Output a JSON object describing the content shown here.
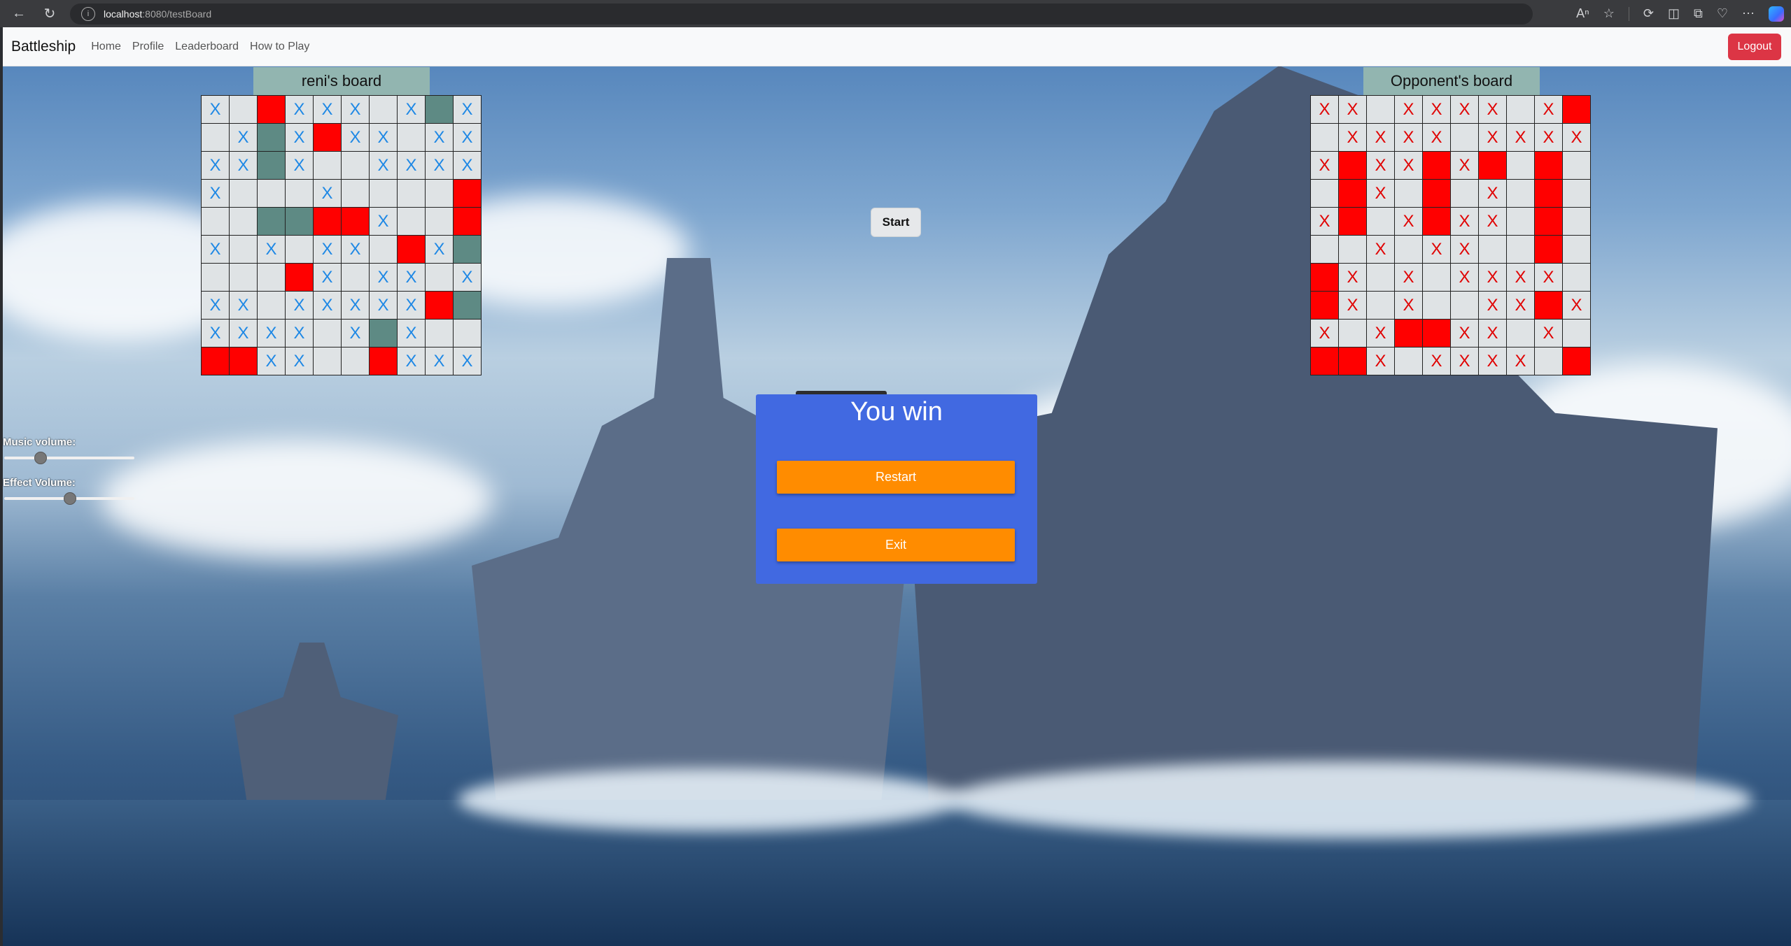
{
  "browser": {
    "url_host": "localhost",
    "url_rest": ":8080/testBoard"
  },
  "navbar": {
    "brand": "Battleship",
    "links": [
      "Home",
      "Profile",
      "Leaderboard",
      "How to Play"
    ],
    "logout_label": "Logout"
  },
  "my_board": {
    "title": "reni's board",
    "rows": [
      "XEHXXXEXSX",
      "EXSXHXXEXX",
      "XXSXEEXXXX",
      "XEEEXEEEEH",
      "EESSHHXEEH",
      "XEXEXXEHXS",
      "EEEHXEXXEX",
      "XXEXXXXXHS",
      "XXXXEXSXEE",
      "HHXXEEHXXX"
    ]
  },
  "opponent_board": {
    "title": "Opponent's board",
    "rows": [
      "XXEXXXXEXH",
      "EXXXXEXXXX",
      "XHXXHXHEHE",
      "EHXEHEXEHE",
      "XHEXHXXEHE",
      "EEXEXXEEHE",
      "HXEXEXXXXE",
      "HXEXEEXXHX",
      "XEXHHXXEXE",
      "HHXEXXXXEH"
    ]
  },
  "start_label": "Start",
  "volume": {
    "music_label": "Music volume:",
    "music_level": 0.25,
    "effect_label": "Effect Volume:",
    "effect_level": 0.5
  },
  "modal": {
    "title": "You win",
    "restart_label": "Restart",
    "exit_label": "Exit",
    "background": "#4169e1",
    "button_color": "#ff8c00"
  },
  "cell_mark": "X"
}
